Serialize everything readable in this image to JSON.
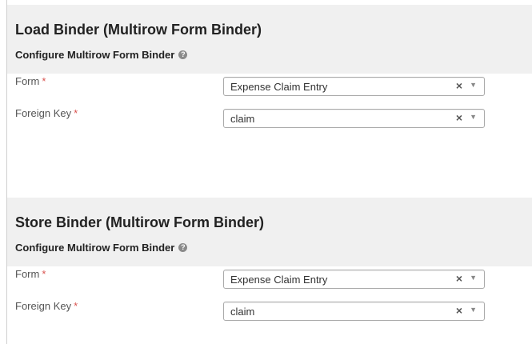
{
  "load_binder": {
    "title": "Load Binder (Multirow Form Binder)",
    "subtitle": "Configure Multirow Form Binder",
    "form": {
      "label": "Form",
      "required": "*",
      "value": "Expense Claim Entry"
    },
    "foreign_key": {
      "label": "Foreign Key",
      "required": "*",
      "value": "claim"
    }
  },
  "store_binder": {
    "title": "Store Binder (Multirow Form Binder)",
    "subtitle": "Configure Multirow Form Binder",
    "form": {
      "label": "Form",
      "required": "*",
      "value": "Expense Claim Entry"
    },
    "foreign_key": {
      "label": "Foreign Key",
      "required": "*",
      "value": "claim"
    }
  },
  "icons": {
    "help": "?",
    "clear": "×",
    "dropdown": "▼"
  },
  "colors": {
    "header_bg": "#f0f0f0",
    "required": "#d9534f"
  }
}
